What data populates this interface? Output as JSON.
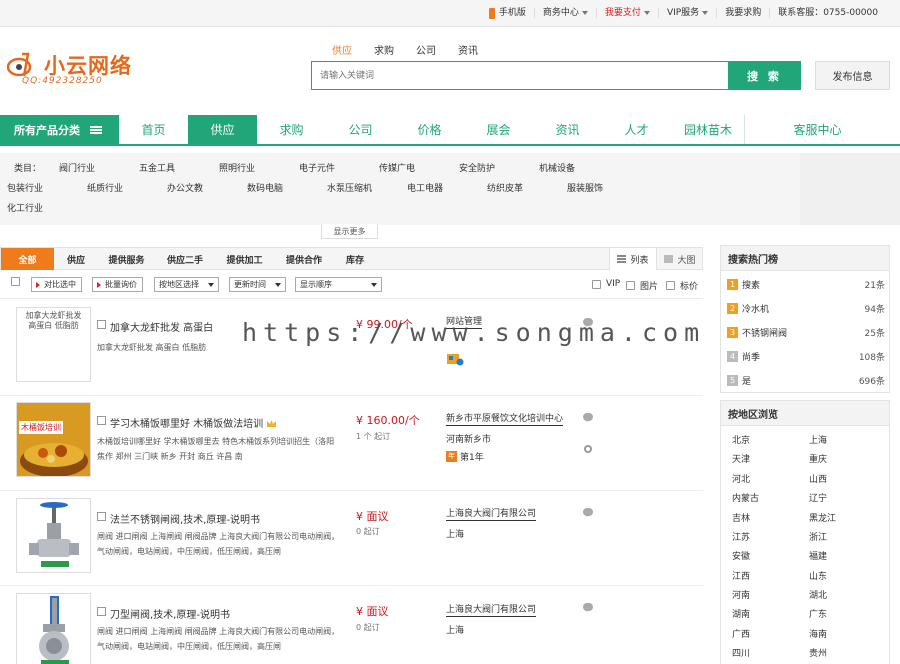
{
  "topbar": {
    "links": [
      {
        "label": "手机版",
        "icon": "phone-icon"
      },
      {
        "label": "商务中心",
        "dropdown": true
      },
      {
        "label": "我要支付",
        "dropdown": true,
        "color": "#e02020"
      },
      {
        "label": "VIP服务",
        "dropdown": true
      },
      {
        "label": "我要求购"
      },
      {
        "label": "联系客服：0755-00000"
      }
    ]
  },
  "logo": {
    "name": "小云网络",
    "sub": "QQ:492328250"
  },
  "search": {
    "tabs": [
      "供应",
      "求购",
      "公司",
      "资讯"
    ],
    "active_tab": 0,
    "placeholder": "请输入关键词",
    "button": "搜 索",
    "publish": "发布信息"
  },
  "nav": {
    "all_categories": "所有产品分类",
    "items": [
      "首页",
      "供应",
      "求购",
      "公司",
      "价格",
      "展会",
      "资讯",
      "人才",
      "园林苗木"
    ],
    "active": 1,
    "service": "客服中心"
  },
  "categories": {
    "label": "类目：",
    "row1": [
      "阀门行业",
      "五金工具",
      "照明行业",
      "电子元件",
      "传媒广电",
      "安全防护",
      "机械设备"
    ],
    "row2": [
      "包装行业",
      "纸质行业",
      "办公文教",
      "数码电脑",
      "水泵压缩机",
      "电工电器",
      "纺织皮革",
      "服装服饰"
    ],
    "row3": [
      "化工行业"
    ],
    "more": "显示更多"
  },
  "list_tabs": {
    "tabs": [
      "全部",
      "供应",
      "提供服务",
      "供应二手",
      "提供加工",
      "提供合作",
      "库存"
    ],
    "active": 0,
    "view_list": "列表",
    "view_grid": "大图"
  },
  "filters": {
    "compare": "对比选中",
    "inquiry": "批量询价",
    "region": "按地区选择",
    "time": "更新时间",
    "order": "显示顺序",
    "vip": "VIP",
    "image": "图片",
    "price": "标价"
  },
  "products": [
    {
      "thumb_alt": "加拿大龙虾批发 高蛋白 低脂肪",
      "title": "加拿大龙虾批发 高蛋白",
      "desc": "加拿大龙虾批发 高蛋白 低脂肪",
      "price": "¥ 99.00/个",
      "min": "",
      "company": "网站管理",
      "location": "",
      "badge": "",
      "crown": false
    },
    {
      "thumb_alt": "木桶饭",
      "thumb_label": "木桶饭培训",
      "title": "学习木桶饭哪里好 木桶饭做法培训",
      "desc": "木桶饭培训哪里好 学木桶饭哪里去 特色木桶饭系列培训招生（洛阳 焦作 郑州 三门峡 新乡 开封 商丘 许昌 南",
      "price": "¥ 160.00/个",
      "min": "1 个 起订",
      "company": "新乡市平原餐饮文化培训中心",
      "location": "河南新乡市",
      "badge": "第1年",
      "crown": true
    },
    {
      "thumb_alt": "法兰不锈钢闸阀",
      "title": "法兰不锈钢闸阀,技术,原理-说明书",
      "desc": "闸阀 进口闸阀 上海闸阀 闸阀品牌 上海良大阀门有限公司电动闸阀，气动闸阀，电站闸阀，中压闸阀，低压闸阀，高压闸",
      "price": "¥ 面议",
      "min": "0 起订",
      "company": "上海良大阀门有限公司",
      "location": "上海",
      "badge": "",
      "crown": false
    },
    {
      "thumb_alt": "刀型闸阀",
      "title": "刀型闸阀,技术,原理-说明书",
      "desc": "闸阀 进口闸阀 上海闸阀 闸阀品牌 上海良大阀门有限公司电动闸阀，气动闸阀，电站闸阀，中压闸阀，低压闸阀，高压闸",
      "price": "¥ 面议",
      "min": "0 起订",
      "company": "上海良大阀门有限公司",
      "location": "上海",
      "badge": "",
      "crown": false
    }
  ],
  "hot_search": {
    "title": "搜索热门榜",
    "items": [
      {
        "rank": "1",
        "term": "搜素",
        "count": "21条",
        "color": "#f0a020"
      },
      {
        "rank": "2",
        "term": "冷水机",
        "count": "94条",
        "color": "#f0a020"
      },
      {
        "rank": "3",
        "term": "不锈钢闸阀",
        "count": "25条",
        "color": "#f0a020"
      },
      {
        "rank": "4",
        "term": "尚季",
        "count": "108条",
        "color": "#bbbbbb"
      },
      {
        "rank": "5",
        "term": "是",
        "count": "696条",
        "color": "#bbbbbb"
      }
    ]
  },
  "regions": {
    "title": "按地区浏览",
    "items": [
      "北京",
      "上海",
      "天津",
      "重庆",
      "河北",
      "山西",
      "内蒙古",
      "辽宁",
      "吉林",
      "黑龙江",
      "江苏",
      "浙江",
      "安徽",
      "福建",
      "江西",
      "山东",
      "河南",
      "湖北",
      "湖南",
      "广东",
      "广西",
      "海南",
      "四川",
      "贵州"
    ]
  },
  "watermark": "https://www.songma.com",
  "colors": {
    "brand": "#21a67a",
    "accent": "#f07b1a",
    "price": "#c8181e"
  }
}
